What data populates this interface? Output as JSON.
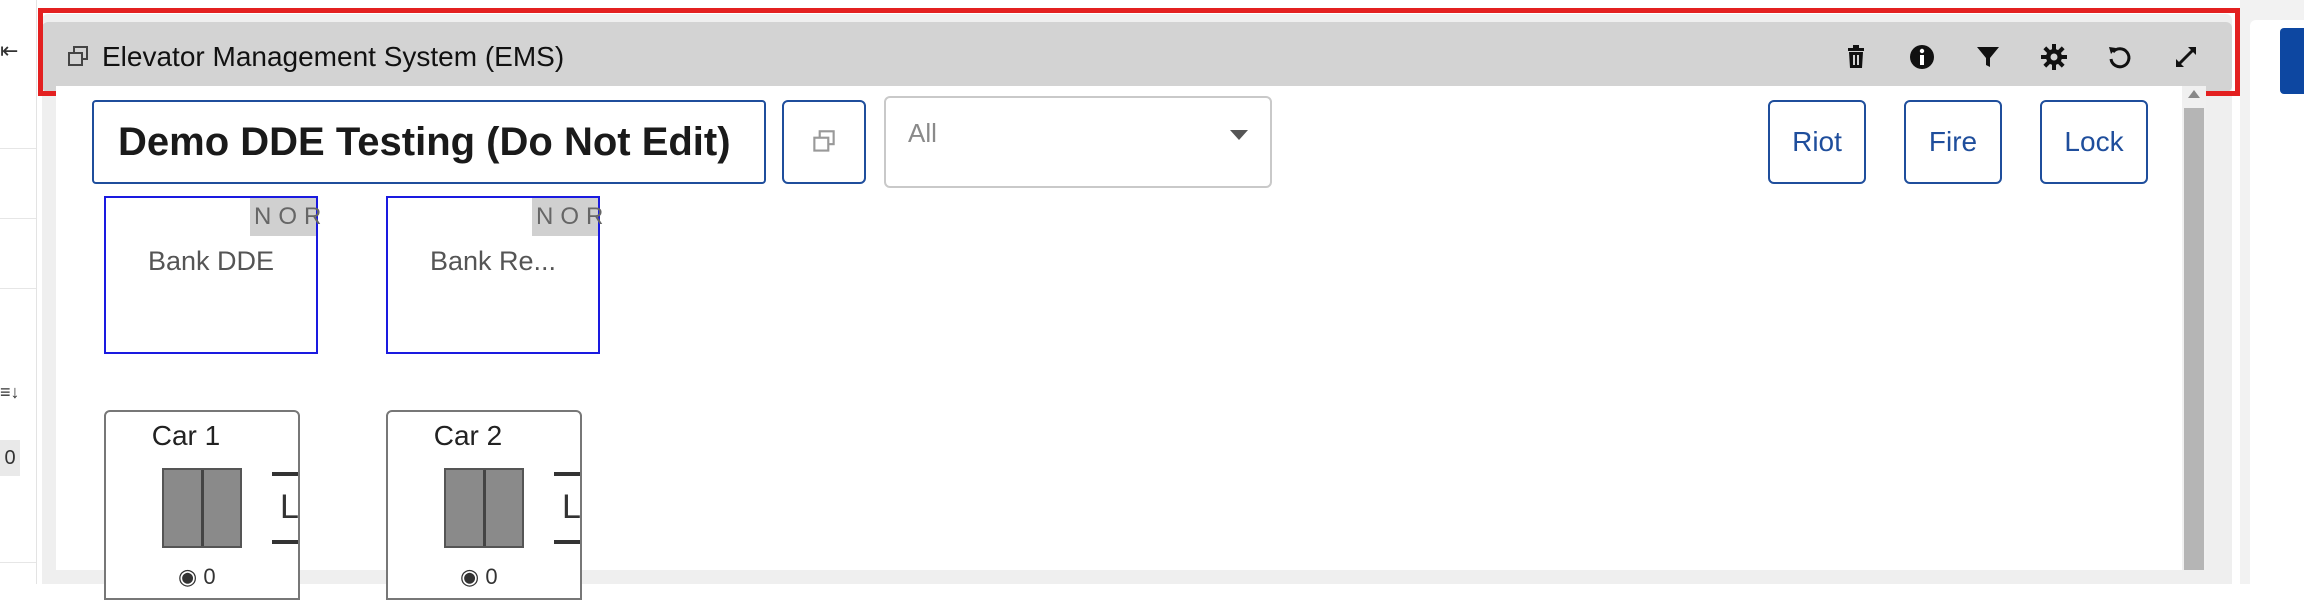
{
  "window": {
    "title": "Elevator Management System (EMS)",
    "tools": [
      "trash-icon",
      "info-icon",
      "filter-icon",
      "gear-icon",
      "refresh-icon",
      "expand-icon"
    ]
  },
  "group": {
    "name": "Demo DDE Testing (Do Not Edit)",
    "filter_value": "All"
  },
  "modes": [
    {
      "label": "Riot"
    },
    {
      "label": "Fire"
    },
    {
      "label": "Lock"
    }
  ],
  "banks": [
    {
      "label": "Bank DDE",
      "status": "NOR"
    },
    {
      "label": "Bank Re...",
      "status": "NOR"
    }
  ],
  "cars": [
    {
      "name": "Car 1",
      "floor": "L",
      "load": "0"
    },
    {
      "name": "Car 2",
      "floor": "L",
      "load": "0"
    }
  ],
  "left_panel": {
    "count": "0"
  },
  "colors": {
    "accent": "#1f4e9c",
    "highlight": "#e32020",
    "bank_border": "#1a1ae0"
  }
}
